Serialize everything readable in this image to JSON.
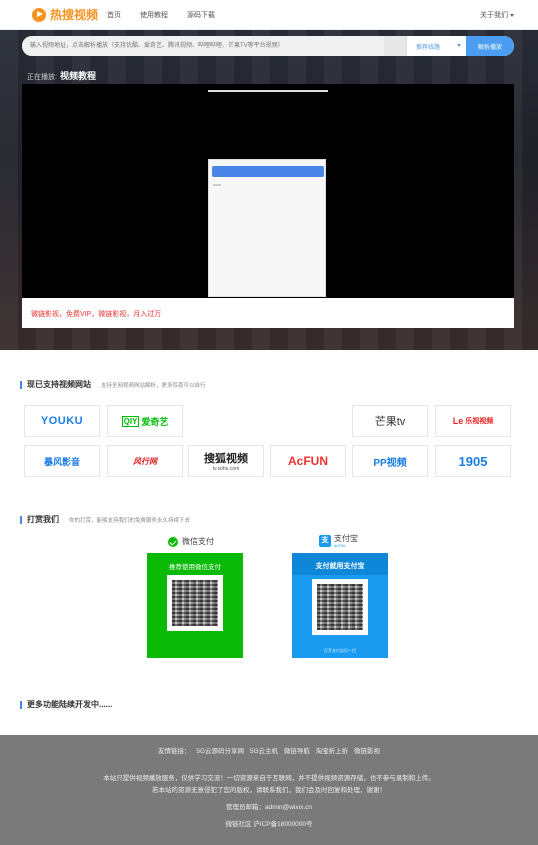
{
  "header": {
    "logo_text": "热搜视频",
    "nav": [
      "首页",
      "使用教程",
      "源码下载"
    ],
    "about_label": "关于我们"
  },
  "search": {
    "placeholder": "输入视频地址，点击解析播放（支持优酷、爱奇艺、腾讯视频、哔哩哔哩、芒果TV等平台视频）",
    "select_value": "推荐线路",
    "button_label": "解析播放"
  },
  "player": {
    "now_playing_label": "正在播放:",
    "now_playing_title": "视频教程",
    "notice_text": "微链影视，免费VIP，微链影视，月入过万"
  },
  "sites": {
    "title": "现已支持视频网站",
    "subtitle": "支持全网视频网站解析，更多惊喜可以自行",
    "cards": [
      "YOUKU",
      "爱奇艺",
      "芒果tv",
      "乐视视频",
      "暴风影音",
      "风行网",
      "搜狐视频",
      "tv.sohu.com",
      "AcFUN",
      "PP视频",
      "1905"
    ]
  },
  "donate": {
    "title": "打赏我们",
    "subtitle": "你的打赏，能够支持我们的免费服务永久持续下去",
    "wechat_label": "微信支付",
    "wechat_head": "推荐使用微信支付",
    "alipay_label": "支付宝",
    "alipay_sub": "ALIPAY",
    "alipay_head": "支付就用支付宝",
    "alipay_foot": "打开支付宝扫一扫"
  },
  "more": {
    "title": "更多功能陆续开发中......"
  },
  "footer": {
    "links_label": "友情链接：",
    "links": [
      "5G云源码分享网",
      "5G云主机",
      "微链导航",
      "淘宝折上折",
      "微链影视"
    ],
    "disclaimer_1": "本站只提供视频播放服务，仅供学习交流！一切资源来自于互联网，并不提供视频资源存储，也不参与录制和上传。",
    "disclaimer_2": "若本站的资源无意侵犯了您的版权，请联系我们，我们会及时回复和处理，谢谢！",
    "email": "管理员邮箱：admin@wlxix.cn",
    "icp": "微链社区  沪ICP备18000000号"
  },
  "colors": {
    "brand": "#f7931e",
    "accent": "#4a9df0",
    "notice": "#ee3333",
    "wechat": "#09bb07",
    "alipay": "#1a9bf0",
    "footer_bg": "#7a7a7a"
  }
}
